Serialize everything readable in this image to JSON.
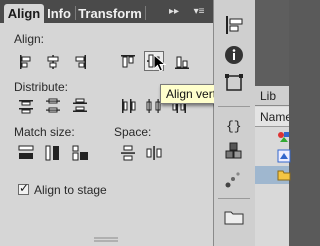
{
  "tabs": [
    {
      "label": "Align",
      "active": true
    },
    {
      "label": "Info",
      "active": false
    },
    {
      "label": "Transform",
      "active": false
    }
  ],
  "tabbar_controls": {
    "collapse": "▸▸",
    "menu": "▾≡"
  },
  "sections": {
    "align": "Align:",
    "distribute": "Distribute:",
    "match_size": "Match size:",
    "space": "Space:"
  },
  "checkbox": {
    "label": "Align to stage",
    "checked": true
  },
  "tooltip": "Align vertical center",
  "right_panel": {
    "tab_label": "Lib",
    "column_label": "Name"
  },
  "colors": {
    "tab_bg": "#4a4a4a",
    "panel_bg": "#d6d6d6",
    "tooltip_bg": "#ffffcc",
    "strip_bg": "#cfcfcf"
  }
}
